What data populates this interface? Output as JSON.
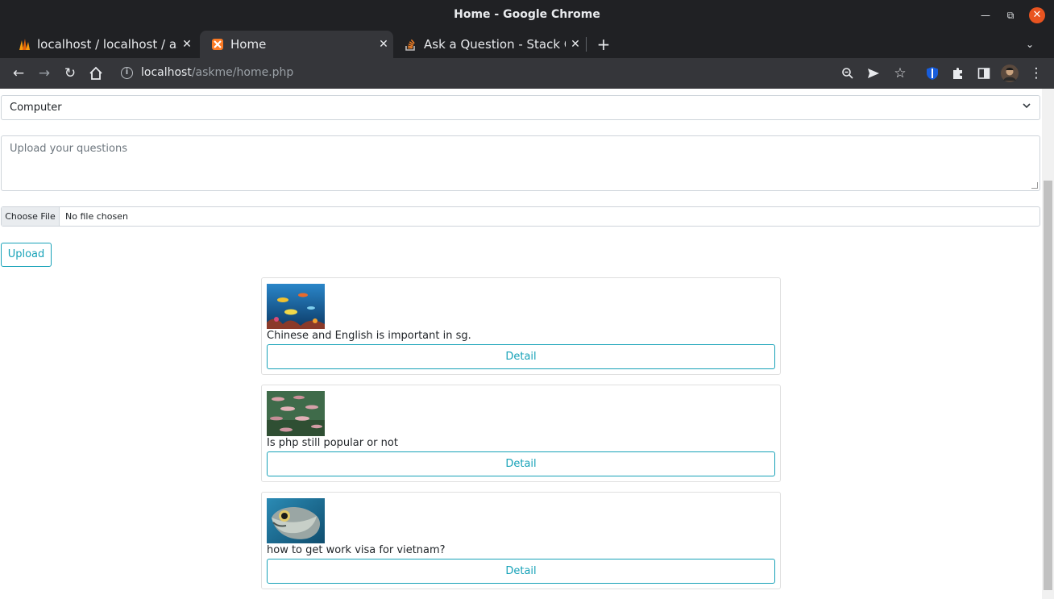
{
  "window": {
    "title": "Home - Google Chrome"
  },
  "tabs": [
    {
      "label": "localhost / localhost / askme",
      "favicon": "phpmyadmin-icon"
    },
    {
      "label": "Home",
      "favicon": "xampp-icon"
    },
    {
      "label": "Ask a Question - Stack Overflow",
      "favicon": "stackoverflow-icon"
    }
  ],
  "toolbar": {
    "url_host": "localhost",
    "url_path": "/askme/home.php"
  },
  "form": {
    "category_selected": "Computer",
    "question_placeholder": "Upload your questions",
    "choose_file_label": "Choose File",
    "no_file_label": "No file chosen",
    "upload_label": "Upload"
  },
  "questions": [
    {
      "text": "Chinese and English is important in sg.",
      "detail_label": "Detail"
    },
    {
      "text": "Is php still popular or not",
      "detail_label": "Detail"
    },
    {
      "text": "how to get work visa for vietnam?",
      "detail_label": "Detail"
    }
  ],
  "colors": {
    "accent": "#17a2b8",
    "chrome_dark": "#202124",
    "chrome_toolbar": "#35363a",
    "close_button": "#e95420"
  }
}
